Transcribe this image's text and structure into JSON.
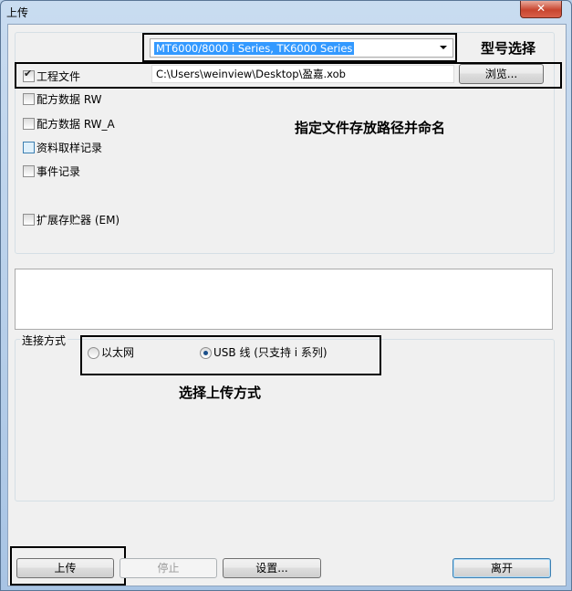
{
  "window": {
    "title": "上传",
    "close_icon": "close-icon"
  },
  "model_select": {
    "value": "MT6000/8000 i Series, TK6000 Series",
    "note": "型号选择"
  },
  "checkboxes": [
    {
      "label": "工程文件",
      "checked": true
    },
    {
      "label": "配方数据 RW",
      "checked": false
    },
    {
      "label": "配方数据 RW_A",
      "checked": false
    },
    {
      "label": "资料取样记录",
      "checked": false
    },
    {
      "label": "事件记录",
      "checked": false
    },
    {
      "label": "扩展存贮器 (EM)",
      "checked": false
    }
  ],
  "file_path": {
    "value": "C:\\Users\\weinview\\Desktop\\盈嘉.xob",
    "browse_label": "浏览...",
    "note": "指定文件存放路径并命名"
  },
  "connection": {
    "group_label": "连接方式",
    "options": [
      {
        "label": "以太网",
        "selected": false
      },
      {
        "label": "USB 线 (只支持 i 系列)",
        "selected": true
      }
    ],
    "note": "选择上传方式"
  },
  "buttons": {
    "upload": "上传",
    "stop": "停止",
    "settings": "设置...",
    "exit": "离开"
  }
}
